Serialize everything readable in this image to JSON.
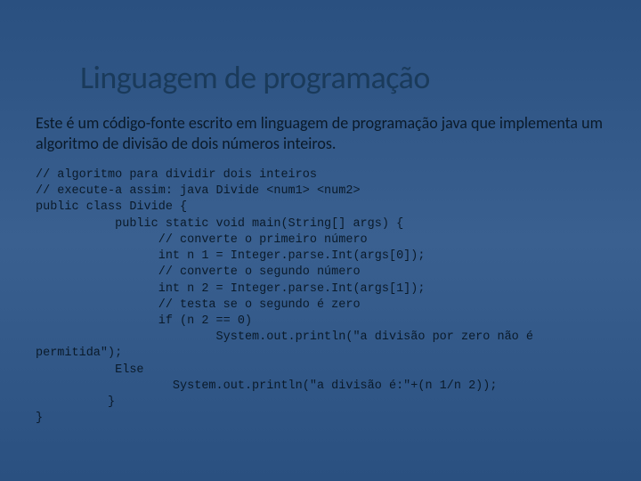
{
  "title": "Linguagem de programação",
  "description": "Este é um código-fonte escrito em linguagem de programação java que implementa um algoritmo de divisão de dois números inteiros.",
  "code": "// algoritmo para dividir dois inteiros\n// execute-a assim: java Divide <num1> <num2>\npublic class Divide {\n           public static void main(String[] args) {\n                 // converte o primeiro número\n                 int n 1 = Integer.parse.Int(args[0]);\n                 // converte o segundo número\n                 int n 2 = Integer.parse.Int(args[1]);\n                 // testa se o segundo é zero\n                 if (n 2 == 0)\n                         System.out.println(\"a divisão por zero não é\npermitida\");\n           Else\n                   System.out.println(\"a divisão é:\"+(n 1/n 2));\n          }\n}"
}
